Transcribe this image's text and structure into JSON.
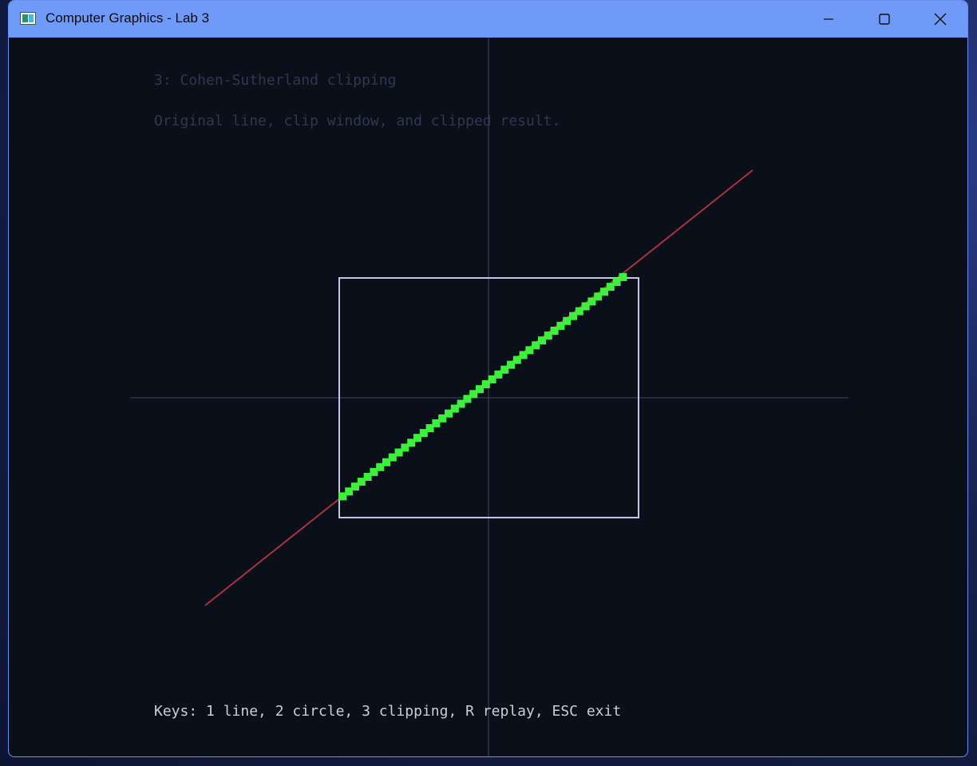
{
  "window": {
    "title": "Computer Graphics - Lab 3",
    "controls": {
      "minimize": "minimize-icon",
      "maximize": "maximize-icon",
      "close": "close-icon"
    }
  },
  "scene": {
    "heading": "3: Cohen-Sutherland clipping",
    "subheading": "Original line, clip window, and clipped result.",
    "footer": "Keys: 1 line, 2 circle, 3 clipping, R replay, ESC exit",
    "colors": {
      "background": "#0b0f19",
      "axes": "#3a4a68",
      "original_line": "#a8323f",
      "clip_window": "#c8c4e6",
      "clipped_line": "#3cf03c"
    }
  }
}
